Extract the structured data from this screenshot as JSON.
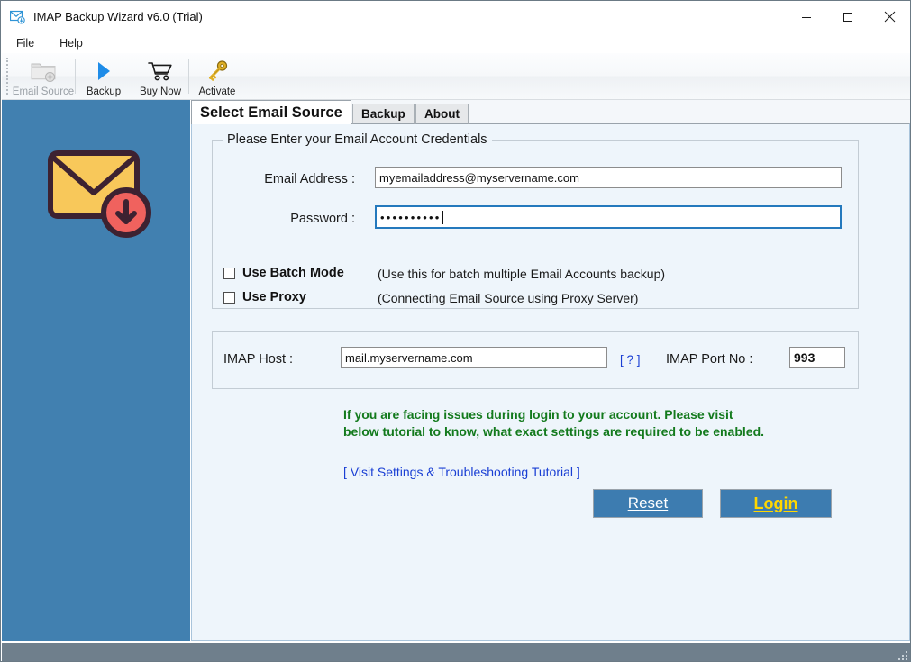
{
  "window": {
    "title": "IMAP Backup Wizard v6.0 (Trial)",
    "icon": "mail-download-icon",
    "minimize": "minimize-icon",
    "maximize": "maximize-icon",
    "close": "close-icon"
  },
  "menubar": {
    "items": [
      {
        "label": "File"
      },
      {
        "label": "Help"
      }
    ]
  },
  "toolbar": {
    "items": [
      {
        "label": "Email Source",
        "icon": "folder-add-icon",
        "disabled": true
      },
      {
        "label": "Backup",
        "icon": "play-icon",
        "disabled": false
      },
      {
        "label": "Buy Now",
        "icon": "shopping-cart-icon",
        "disabled": false
      },
      {
        "label": "Activate",
        "icon": "key-icon",
        "disabled": false
      }
    ]
  },
  "sidebar": {
    "icon": "envelope-download-icon",
    "background_color": "#4180b0"
  },
  "tabs": [
    {
      "label": "Select Email Source",
      "active": true
    },
    {
      "label": "Backup",
      "active": false
    },
    {
      "label": "About",
      "active": false
    }
  ],
  "credentials": {
    "legend": "Please Enter your Email Account Credentials",
    "email_label": "Email Address :",
    "email_value": "myemailaddress@myservername.com",
    "email_placeholder": "",
    "password_label": "Password :",
    "password_value": "••••••••••",
    "password_placeholder": "",
    "batch_mode": {
      "label": "Use Batch Mode",
      "hint": "(Use this for batch multiple Email Accounts backup)",
      "checked": false
    },
    "use_proxy": {
      "label": "Use Proxy",
      "hint": "(Connecting Email Source using Proxy Server)",
      "checked": false
    }
  },
  "imap": {
    "host_label": "IMAP Host :",
    "host_value": "mail.myservername.com",
    "host_placeholder": "",
    "help_link": "[ ? ]",
    "port_label": "IMAP Port No :",
    "port_value": "993"
  },
  "notice": {
    "message": "If you are facing issues during login to your account. Please visit below tutorial to know, what exact settings are required to be enabled.",
    "color": "#137a1d",
    "tutorial_link": "[ Visit Settings & Troubleshooting Tutorial ]",
    "link_color": "#1a3fd4"
  },
  "actions": {
    "reset_label": "Reset",
    "reset_accel": "R",
    "login_label": "Login",
    "login_accel": "L",
    "button_color": "#3d7cb0",
    "login_text_color": "#ffd700"
  },
  "statusbar": {
    "text": "",
    "background_color": "#6f7f8c"
  }
}
